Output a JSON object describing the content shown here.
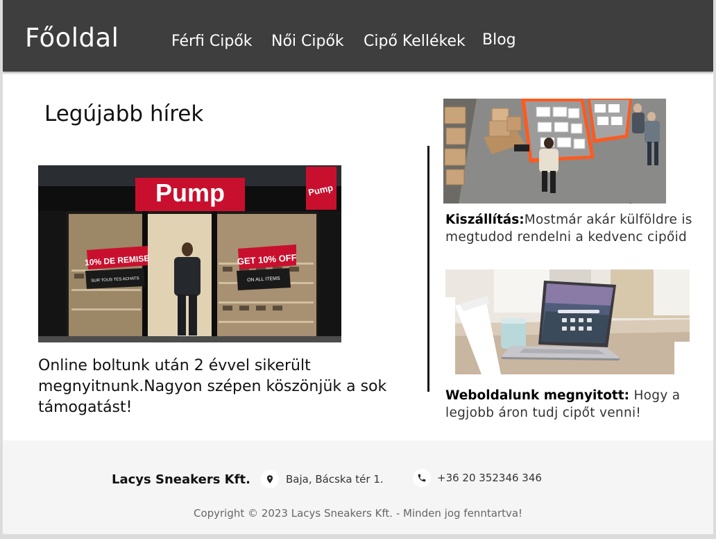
{
  "nav": {
    "brand": "Főoldal",
    "links": [
      "Férfi Cipők",
      "Női Cipők",
      "Cipő Kellékek",
      "Blog"
    ]
  },
  "main": {
    "title": "Legújabb hírek",
    "featured": {
      "store_sign": "Pump",
      "poster_left_line1": "10% DE REMISE",
      "poster_left_line2": "SUR TOUS TES ACHATS",
      "poster_right_line1": "GET 10% OFF",
      "poster_right_line2": "ON ALL ITEMS",
      "caption": "Online boltunk után 2 évvel sikerült megnyitnunk.Nagyon szépen köszönjük a sok támogatást!"
    },
    "side": [
      {
        "heading": "Kiszállítás:",
        "text": "Mostmár akár külföldre is megtudod rendelni a kedvenc cipőid"
      },
      {
        "heading": "Weboldalunk megnyitott: ",
        "text": "Hogy a legjobb áron  tudj cipőt venni!"
      }
    ]
  },
  "footer": {
    "company": "Lacys Sneakers Kft.",
    "address": "Baja, Bácska tér 1.",
    "phone": "+36 20 352346 346",
    "copyright": "Copyright © 2023 Lacys Sneakers Kft. - Minden jog fenntartva!"
  },
  "colors": {
    "navbar": "#3e3e3e",
    "footer": "#f5f5f5",
    "sign_red": "#c8102e"
  }
}
